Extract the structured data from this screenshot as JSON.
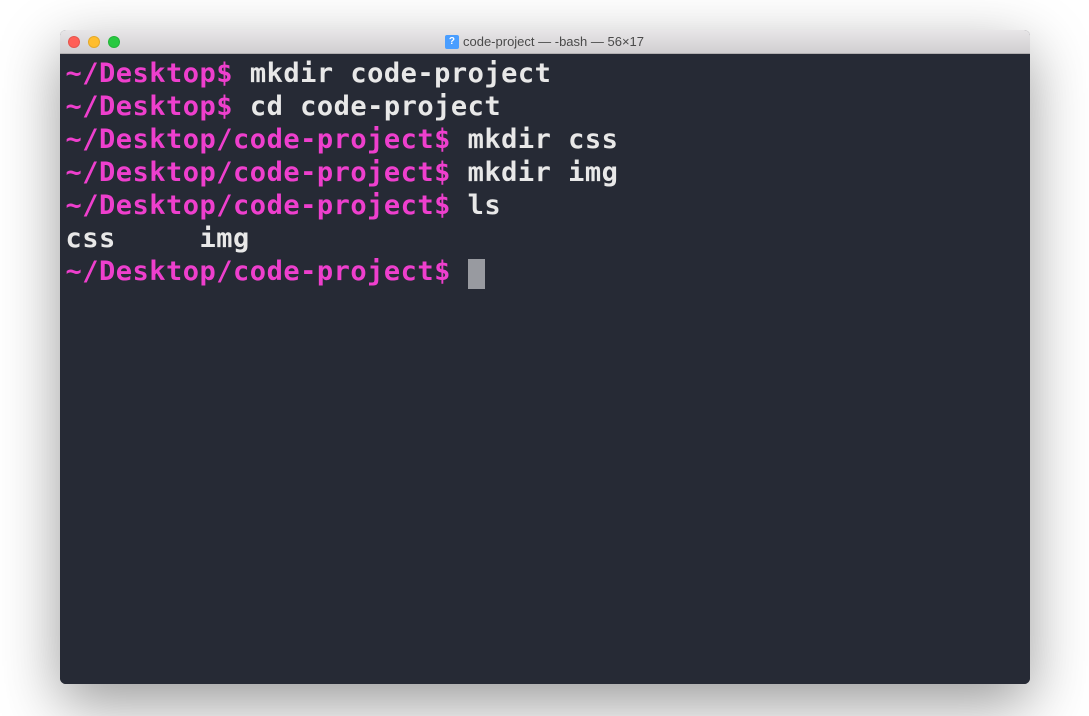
{
  "window": {
    "title": "code-project — -bash — 56×17",
    "icon_label": "?"
  },
  "terminal": {
    "lines": [
      {
        "prompt": "~/Desktop$",
        "command": "mkdir code-project"
      },
      {
        "prompt": "~/Desktop$",
        "command": "cd code-project"
      },
      {
        "prompt": "~/Desktop/code-project$",
        "command": "mkdir css"
      },
      {
        "prompt": "~/Desktop/code-project$",
        "command": "mkdir img"
      },
      {
        "prompt": "~/Desktop/code-project$",
        "command": "ls"
      }
    ],
    "output": "css     img",
    "current_prompt": "~/Desktop/code-project$"
  }
}
